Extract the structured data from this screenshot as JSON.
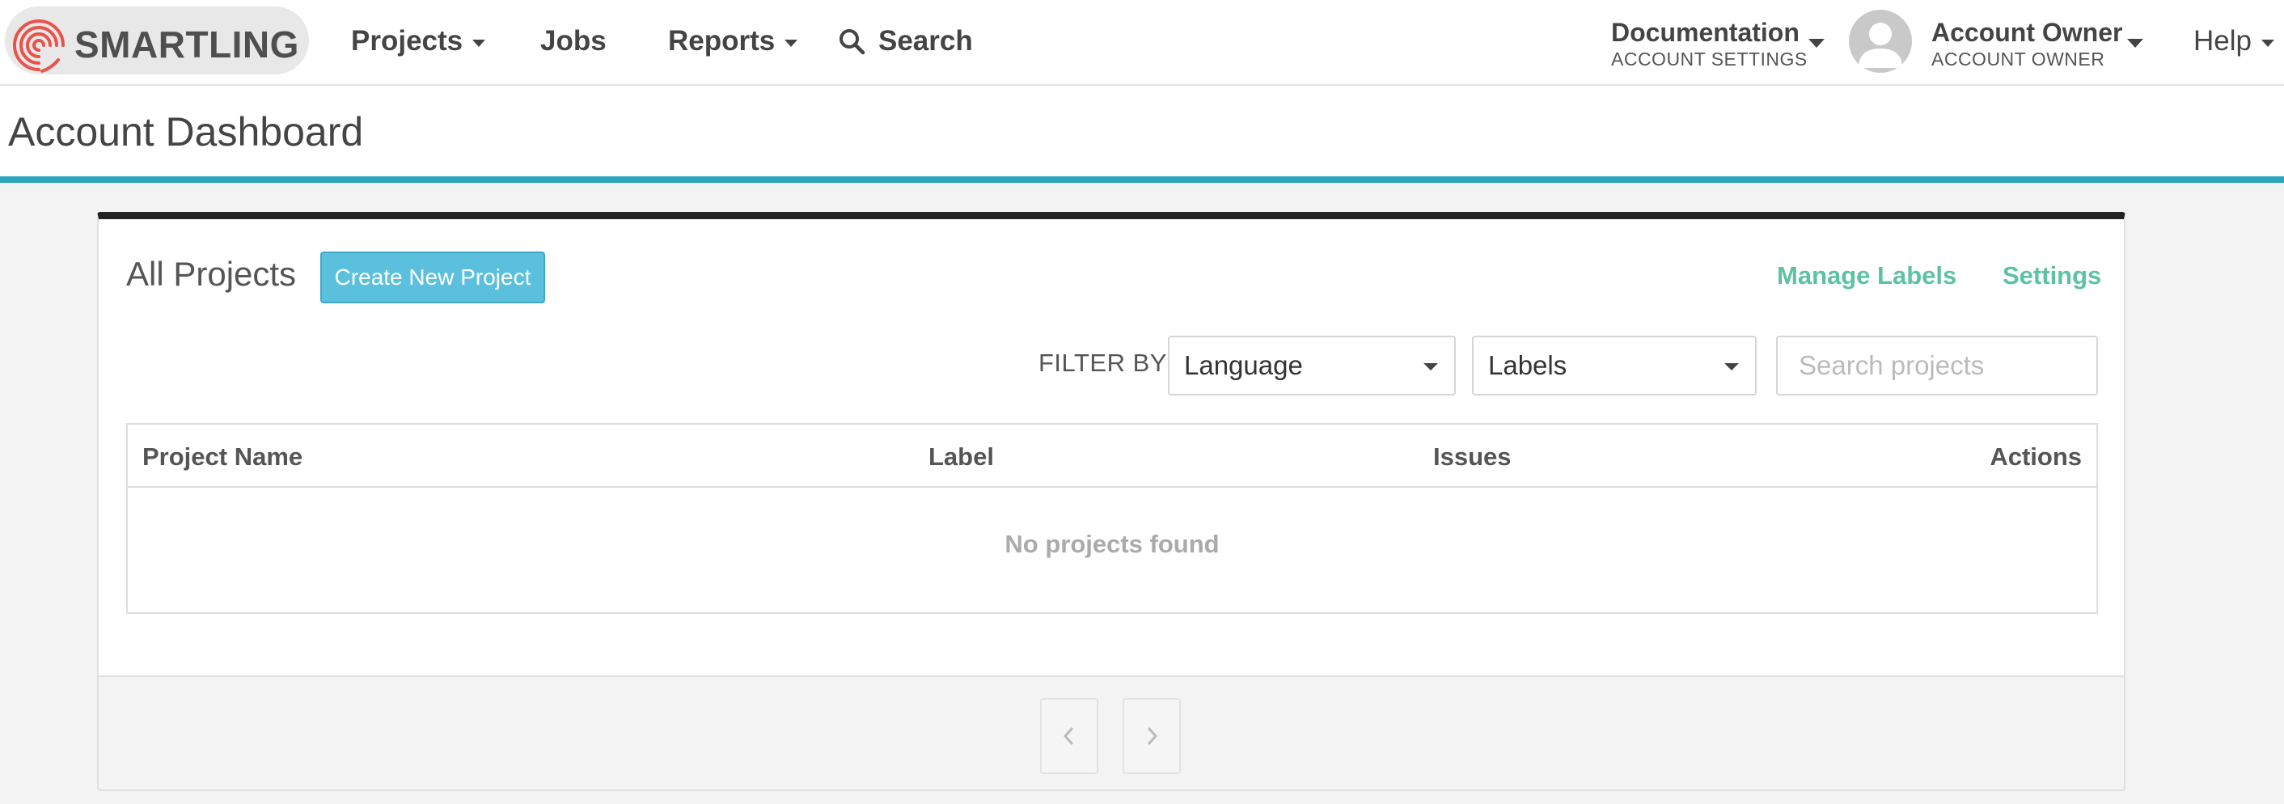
{
  "brand": {
    "name": "SMARTLING",
    "accent_color": "#2aa5bd",
    "logo_color": "#e8534a"
  },
  "nav": {
    "projects": "Projects",
    "jobs": "Jobs",
    "reports": "Reports",
    "search": "Search",
    "help": "Help"
  },
  "account_switcher": {
    "title": "Documentation",
    "subtitle": "ACCOUNT SETTINGS"
  },
  "user_menu": {
    "name": "Account Owner",
    "role": "ACCOUNT OWNER"
  },
  "page": {
    "title": "Account Dashboard"
  },
  "card": {
    "title": "All Projects",
    "create_button": "Create New Project",
    "manage_labels_link": "Manage Labels",
    "settings_link": "Settings",
    "link_color": "#5cc2a4",
    "button_color": "#5bc0de"
  },
  "filters": {
    "label": "FILTER BY",
    "language": {
      "selected": "Language"
    },
    "labels": {
      "selected": "Labels"
    },
    "search": {
      "placeholder": "Search projects",
      "value": ""
    }
  },
  "table": {
    "columns": [
      "Project Name",
      "Label",
      "Issues",
      "Actions"
    ],
    "rows": [],
    "empty_message": "No projects found"
  },
  "pagination": {
    "prev": "chevron-left-icon",
    "next": "chevron-right-icon"
  }
}
